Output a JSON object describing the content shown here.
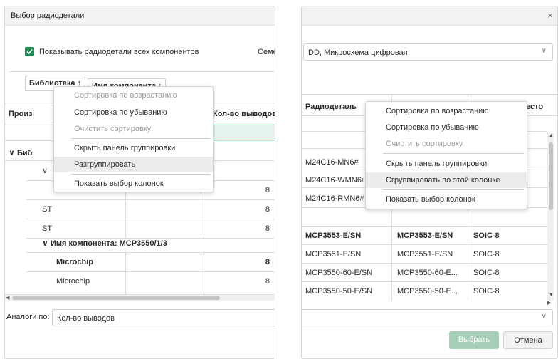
{
  "left_window": {
    "title": "Выбор радиодетали",
    "show_all_label": "Показывать радиодетали всех компонентов",
    "family_label_partial": "Семе",
    "group_chips": [
      "Библиотека ↑",
      "Имя компонента ↑"
    ],
    "columns": [
      "Произ",
      "Кол-во выводов"
    ],
    "group_rows": {
      "library": "Биб",
      "component_group": "Имя компонента: MCP3550/1/3"
    },
    "rows_top": [
      {
        "manufacturer": "",
        "pins": "8"
      },
      {
        "manufacturer": "ST",
        "pins": "8"
      },
      {
        "manufacturer": "ST",
        "pins": "8"
      }
    ],
    "rows_bottom": [
      {
        "manufacturer": "Microchip",
        "pins": "8",
        "bold": true
      },
      {
        "manufacturer": "Microchip",
        "pins": "8",
        "bold": false
      }
    ],
    "analogs_label": "Аналоги по:",
    "analogs_value": "Кол-во выводов",
    "context_menu": [
      "Сортировка по возрастанию",
      "Сортировка по убыванию",
      "Очистить сортировку",
      "Скрыть панель группировки",
      "Разгруппировать",
      "Показать выбор колонок"
    ]
  },
  "right_window": {
    "close_glyph": "×",
    "type_combo": "DD, Микросхема цифровая",
    "columns": [
      "Радиодеталь",
      "есто"
    ],
    "partial_rows": [
      "M24C16-MN6#",
      "M24C16-WMN6i",
      "M24C16-RMN6#"
    ],
    "rows": [
      {
        "part": "MCP3553-E/SN",
        "component": "MCP3553-E/SN",
        "package": "SOIC-8",
        "bold": true
      },
      {
        "part": "MCP3551-E/SN",
        "component": "MCP3551-E/SN",
        "package": "SOIC-8",
        "bold": false
      },
      {
        "part": "MCP3550-60-E/SN",
        "component": "MCP3550-60-E...",
        "package": "SOIC-8",
        "bold": false
      },
      {
        "part": "MCP3550-50-E/SN",
        "component": "MCP3550-50-E...",
        "package": "SOIC-8",
        "bold": false
      }
    ],
    "context_menu": [
      "Сортировка по возрастанию",
      "Сортировка по убыванию",
      "Очистить сортировку",
      "Скрыть панель группировки",
      "Сгруппировать по этой колонке",
      "Показать выбор колонок"
    ],
    "select_button": "Выбрать",
    "cancel_button": "Отмена"
  },
  "colors": {
    "accent_green": "#1e8a52",
    "selection_bg": "#e6f2ec",
    "menu_highlight": "#ececec"
  }
}
